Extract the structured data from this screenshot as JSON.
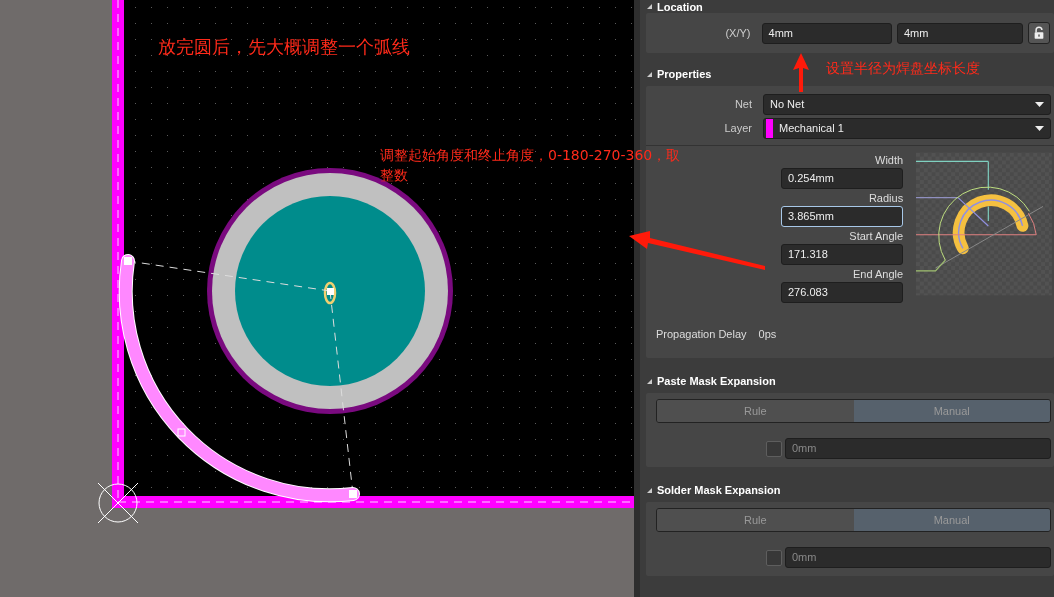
{
  "canvas": {
    "annotations": [
      {
        "text": "放完圆后，先大概调整一个弧线"
      },
      {
        "text": "调整起始角度和终止角度，0-180-270-360，取整数"
      }
    ]
  },
  "panel_note": {
    "text": "设置半径为焊盘坐标长度"
  },
  "location": {
    "title": "Location",
    "label": "(X/Y)",
    "x": "4mm",
    "y": "4mm",
    "locked": false
  },
  "properties": {
    "title": "Properties",
    "net": {
      "label": "Net",
      "value": "No Net"
    },
    "layer": {
      "label": "Layer",
      "value": "Mechanical 1",
      "color": "#ff00ff"
    },
    "fields": [
      {
        "label": "Width",
        "value": "0.254mm",
        "focused": false
      },
      {
        "label": "Radius",
        "value": "3.865mm",
        "focused": true
      },
      {
        "label": "Start Angle",
        "value": "171.318",
        "focused": false
      },
      {
        "label": "End Angle",
        "value": "276.083",
        "focused": false
      }
    ],
    "propagation": {
      "label": "Propagation Delay",
      "value": "0ps"
    }
  },
  "masks": [
    {
      "title": "Paste Mask Expansion",
      "options": [
        {
          "label": "Rule",
          "selected": false
        },
        {
          "label": "Manual",
          "selected": true
        }
      ],
      "checked": false,
      "disabled": true,
      "value": "0mm"
    },
    {
      "title": "Solder Mask Expansion",
      "options": [
        {
          "label": "Rule",
          "selected": false
        },
        {
          "label": "Manual",
          "selected": true
        }
      ],
      "checked": false,
      "disabled": true,
      "value": "0mm"
    }
  ]
}
